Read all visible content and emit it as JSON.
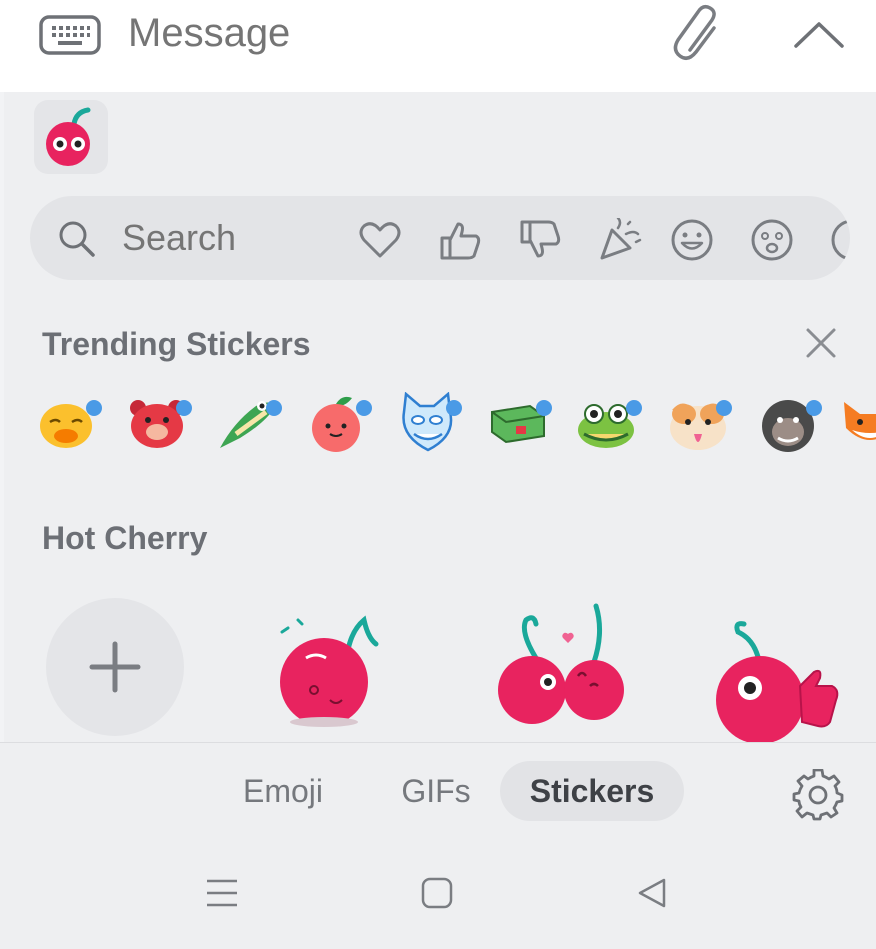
{
  "message_bar": {
    "placeholder": "Message",
    "keyboard_icon": "keyboard-icon",
    "attach_icon": "paperclip-icon",
    "expand_icon": "chevron-up-icon"
  },
  "search": {
    "placeholder": "Search",
    "categories": [
      "heart",
      "thumbs-up",
      "thumbs-down",
      "party",
      "smile",
      "sad",
      "more"
    ]
  },
  "trending": {
    "title": "Trending Stickers",
    "close_icon": "close-icon",
    "stickers": [
      "duck",
      "bear",
      "lizard",
      "peach",
      "cat",
      "frog-block",
      "frog",
      "dog",
      "gorilla",
      "fox"
    ],
    "new_dot_color": "#4a9ae6"
  },
  "pack": {
    "title": "Hot Cherry",
    "add_icon": "plus-icon",
    "stickers": [
      "cherry-dizzy",
      "cherry-kiss",
      "cherry-thumbs-up"
    ]
  },
  "tabs": {
    "items": [
      {
        "label": "Emoji"
      },
      {
        "label": "GIFs"
      },
      {
        "label": "Stickers"
      }
    ],
    "active": "Stickers",
    "settings_icon": "gear-icon"
  },
  "system_nav": {
    "icons": [
      "menu-icon",
      "home-icon",
      "back-icon"
    ]
  },
  "colors": {
    "cherry": "#e8235f",
    "stem": "#1aa89a",
    "accent_dot": "#4a9ae6"
  }
}
